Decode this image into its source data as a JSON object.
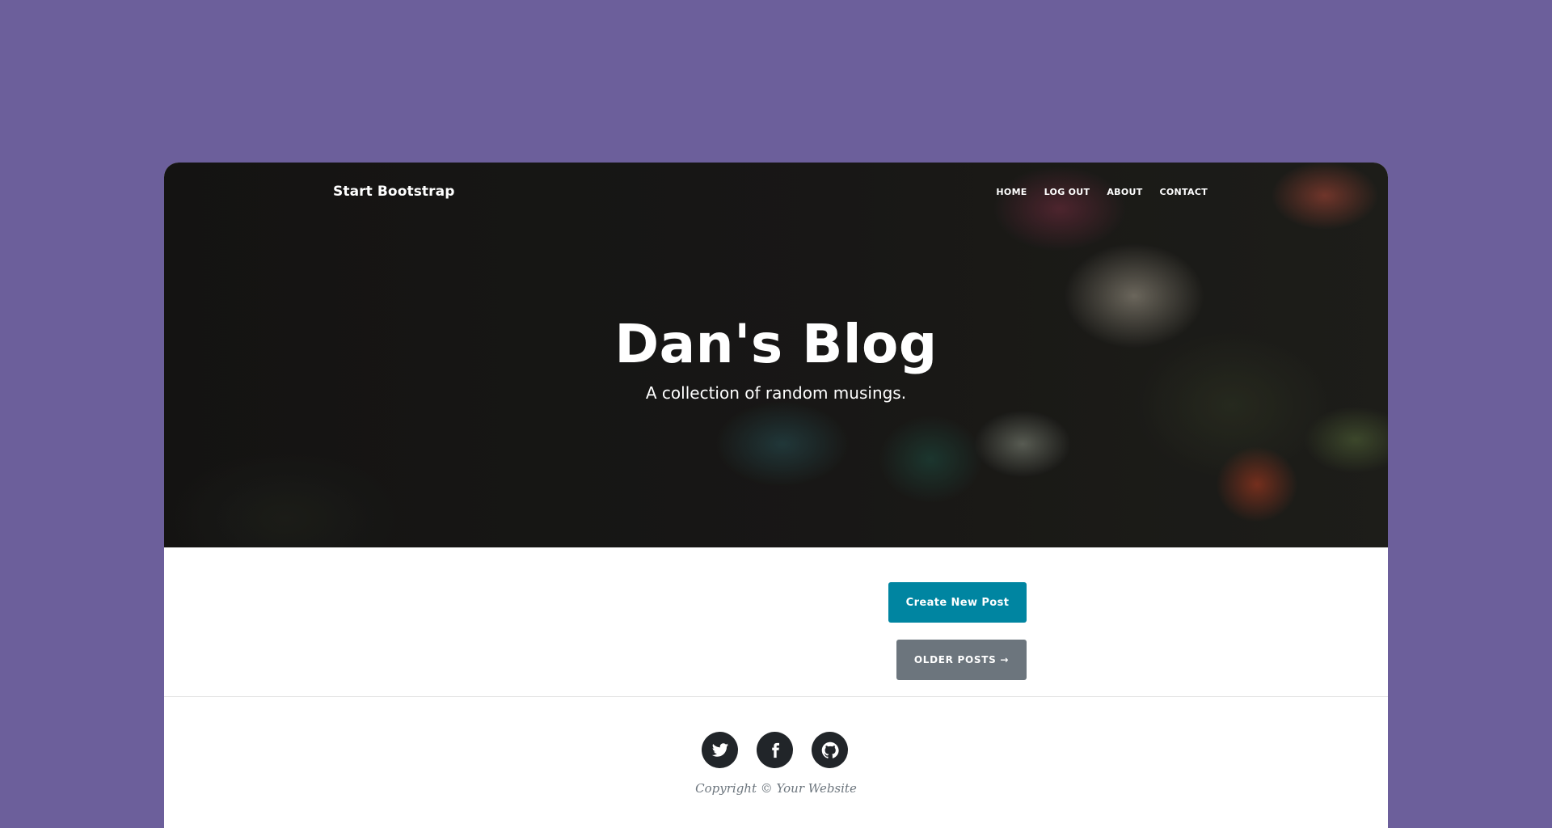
{
  "navbar": {
    "brand": "Start Bootstrap",
    "links": [
      "HOME",
      "LOG OUT",
      "ABOUT",
      "CONTACT"
    ]
  },
  "hero": {
    "heading": "Dan's Blog",
    "subheading": "A collection of random musings."
  },
  "actions": {
    "create_post": "Create New Post",
    "older_posts": "OLDER POSTS →"
  },
  "footer": {
    "social": [
      "twitter-icon",
      "facebook-icon",
      "github-icon"
    ],
    "copyright": "Copyright © Your Website"
  },
  "colors": {
    "page_background": "#6c5f9b",
    "primary_button": "#0085a1",
    "secondary_button": "#6c757d",
    "social_icon_bg": "#212529"
  }
}
